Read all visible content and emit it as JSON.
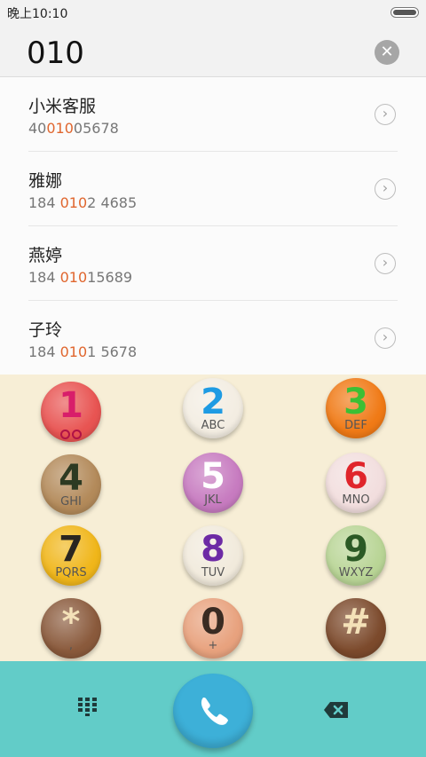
{
  "status_bar": {
    "time": "晚上10:10"
  },
  "search": {
    "query": "010",
    "clear_icon": "close-icon"
  },
  "results": [
    {
      "name": "小米客服",
      "number_pre": "40",
      "number_match": "010",
      "number_post": "05678"
    },
    {
      "name": "雅娜",
      "number_pre": "184 ",
      "number_match": "010",
      "number_post": "2 4685"
    },
    {
      "name": "燕婷",
      "number_pre": "184 ",
      "number_match": "010",
      "number_post": "15689"
    },
    {
      "name": "子玲",
      "number_pre": "184 ",
      "number_match": "010",
      "number_post": "1 5678"
    }
  ],
  "keypad": {
    "keys": [
      {
        "digit": "1",
        "letters": "",
        "color": "#e85452",
        "digit_color": "#d81e6a"
      },
      {
        "digit": "2",
        "letters": "ABC",
        "color": "#f3ede2",
        "digit_color": "#1e9be3"
      },
      {
        "digit": "3",
        "letters": "DEF",
        "color": "#f07a16",
        "digit_color": "#3cbf34"
      },
      {
        "digit": "4",
        "letters": "GHI",
        "color": "#b38a5a",
        "digit_color": "#2d3a22"
      },
      {
        "digit": "5",
        "letters": "JKL",
        "color": "#c77bc0",
        "digit_color": "#ffffff"
      },
      {
        "digit": "6",
        "letters": "MNO",
        "color": "#f2dede",
        "digit_color": "#e0252b"
      },
      {
        "digit": "7",
        "letters": "PQRS",
        "color": "#f0b61a",
        "digit_color": "#2a2520"
      },
      {
        "digit": "8",
        "letters": "TUV",
        "color": "#f1eadc",
        "digit_color": "#6d2aa5"
      },
      {
        "digit": "9",
        "letters": "WXYZ",
        "color": "#b9d596",
        "digit_color": "#2b5a25"
      },
      {
        "digit": "*",
        "letters": ",",
        "color": "#8a5a3c",
        "digit_color": "#f4e1b8"
      },
      {
        "digit": "0",
        "letters": "+",
        "color": "#e8a27e",
        "digit_color": "#3a2b22"
      },
      {
        "digit": "#",
        "letters": "",
        "color": "#7c4a2c",
        "digit_color": "#f4e1b8"
      }
    ]
  },
  "bottom": {
    "dialpad_icon": "dialpad-icon",
    "call_icon": "phone-icon",
    "backspace_icon": "backspace-icon"
  }
}
